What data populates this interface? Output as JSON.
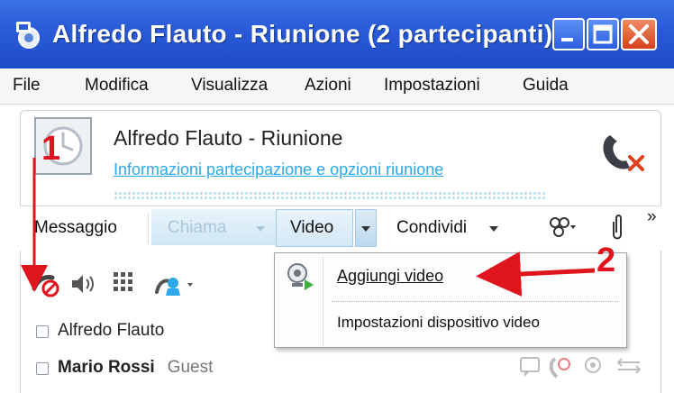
{
  "window": {
    "title": "Alfredo Flauto - Riunione (2 partecipanti)",
    "controls": [
      "minimize",
      "maximize",
      "close"
    ]
  },
  "menu": {
    "items": [
      {
        "label": "File"
      },
      {
        "label": "Modifica"
      },
      {
        "label": "Visualizza"
      },
      {
        "label": "Azioni"
      },
      {
        "label": "Impostazioni"
      },
      {
        "label": "Guida"
      }
    ]
  },
  "conversation": {
    "title": "Alfredo Flauto - Riunione",
    "info_link": "Informazioni partecipazione e opzioni riunione",
    "avatar_icon": "clock-avatar-icon",
    "hangup_icon": "hang-up-phone-icon"
  },
  "toolbar": {
    "message": "Messaggio",
    "call": "Chiama",
    "video": "Video",
    "share": "Condividi",
    "more": "»",
    "call_state": "disabled"
  },
  "participant_toolbar": {
    "icons": [
      "mute-audio-icon",
      "speaker-icon",
      "dialpad-icon",
      "add-participant-icon"
    ]
  },
  "participants": [
    {
      "name": "Alfredo Flauto",
      "role": ""
    },
    {
      "name": "Mario Rossi",
      "role": "Guest"
    }
  ],
  "video_menu": {
    "items": [
      {
        "label": "Aggiungi video",
        "icon": "webcam-start-icon"
      },
      {
        "label": "Impostazioni dispositivo video",
        "icon": ""
      }
    ]
  },
  "annotations": {
    "step1": "1",
    "step2": "2",
    "color": "#e0141c"
  },
  "colors": {
    "titlebar": "#2a5ad8",
    "link": "#2ea8e8",
    "close_button": "#d6401c"
  }
}
